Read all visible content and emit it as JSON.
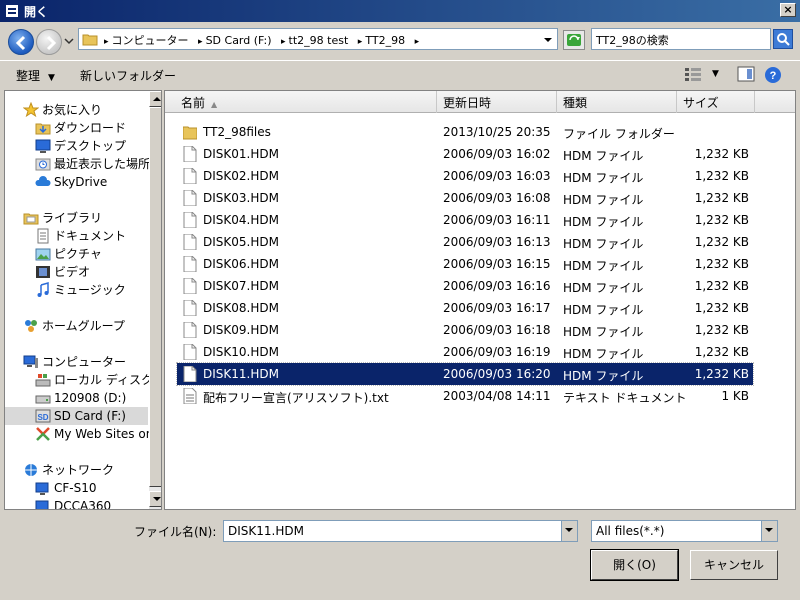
{
  "window": {
    "title": "開く",
    "close": "×"
  },
  "address": {
    "crumbs": [
      "コンピューター",
      "SD Card (F:)",
      "tt2_98 test",
      "TT2_98"
    ],
    "crumb_sep": "▸",
    "search_placeholder": "TT2_98の検索"
  },
  "toolbar": {
    "organize_label": "整理",
    "new_folder_label": "新しいフォルダー",
    "dropdown_glyph": "▼"
  },
  "nav": {
    "items": [
      {
        "label": "お気に入り",
        "icon": "star-icon"
      },
      {
        "label": "ダウンロード",
        "icon": "download-folder-icon"
      },
      {
        "label": "デスクトップ",
        "icon": "desktop-icon"
      },
      {
        "label": "最近表示した場所",
        "icon": "recent-places-icon"
      },
      {
        "label": "SkyDrive",
        "icon": "cloud-icon"
      },
      {
        "label": "ライブラリ",
        "icon": "library-icon"
      },
      {
        "label": "ドキュメント",
        "icon": "documents-icon"
      },
      {
        "label": "ピクチャ",
        "icon": "pictures-icon"
      },
      {
        "label": "ビデオ",
        "icon": "video-icon"
      },
      {
        "label": "ミュージック",
        "icon": "music-icon"
      },
      {
        "label": "ホームグループ",
        "icon": "homegroup-icon"
      },
      {
        "label": "コンピューター",
        "icon": "computer-icon"
      },
      {
        "label": "ローカル ディスク (C",
        "icon": "local-disk-icon"
      },
      {
        "label": "120908 (D:)",
        "icon": "drive-icon"
      },
      {
        "label": "SD Card (F:)",
        "icon": "sd-card-icon"
      },
      {
        "label": "My Web Sites on",
        "icon": "web-sites-icon"
      },
      {
        "label": "ネットワーク",
        "icon": "network-icon"
      },
      {
        "label": "CF-S10",
        "icon": "network-pc-icon"
      },
      {
        "label": "DCCA360",
        "icon": "network-pc-icon"
      }
    ]
  },
  "files": {
    "headers": {
      "name": "名前",
      "date": "更新日時",
      "type": "種類",
      "size": "サイズ"
    },
    "sort_glyph": "▲",
    "rows": [
      {
        "name": "TT2_98files",
        "date": "2013/10/25 20:35",
        "type": "ファイル フォルダー",
        "size": "",
        "kind": "folder"
      },
      {
        "name": "DISK01.HDM",
        "date": "2006/09/03 16:02",
        "type": "HDM ファイル",
        "size": "1,232 KB",
        "kind": "file"
      },
      {
        "name": "DISK02.HDM",
        "date": "2006/09/03 16:03",
        "type": "HDM ファイル",
        "size": "1,232 KB",
        "kind": "file"
      },
      {
        "name": "DISK03.HDM",
        "date": "2006/09/03 16:08",
        "type": "HDM ファイル",
        "size": "1,232 KB",
        "kind": "file"
      },
      {
        "name": "DISK04.HDM",
        "date": "2006/09/03 16:11",
        "type": "HDM ファイル",
        "size": "1,232 KB",
        "kind": "file"
      },
      {
        "name": "DISK05.HDM",
        "date": "2006/09/03 16:13",
        "type": "HDM ファイル",
        "size": "1,232 KB",
        "kind": "file"
      },
      {
        "name": "DISK06.HDM",
        "date": "2006/09/03 16:15",
        "type": "HDM ファイル",
        "size": "1,232 KB",
        "kind": "file"
      },
      {
        "name": "DISK07.HDM",
        "date": "2006/09/03 16:16",
        "type": "HDM ファイル",
        "size": "1,232 KB",
        "kind": "file"
      },
      {
        "name": "DISK08.HDM",
        "date": "2006/09/03 16:17",
        "type": "HDM ファイル",
        "size": "1,232 KB",
        "kind": "file"
      },
      {
        "name": "DISK09.HDM",
        "date": "2006/09/03 16:18",
        "type": "HDM ファイル",
        "size": "1,232 KB",
        "kind": "file"
      },
      {
        "name": "DISK10.HDM",
        "date": "2006/09/03 16:19",
        "type": "HDM ファイル",
        "size": "1,232 KB",
        "kind": "file"
      },
      {
        "name": "DISK11.HDM",
        "date": "2006/09/03 16:20",
        "type": "HDM ファイル",
        "size": "1,232 KB",
        "kind": "file",
        "selected": true
      },
      {
        "name": "配布フリー宣言(アリスソフト).txt",
        "date": "2003/04/08 14:11",
        "type": "テキスト ドキュメント",
        "size": "1 KB",
        "kind": "text"
      }
    ]
  },
  "bottom": {
    "filename_label": "ファイル名(N):",
    "filename_value": "DISK11.HDM",
    "filter_value": "All files(*.*)",
    "open_label": "開く(O)",
    "cancel_label": "キャンセル"
  }
}
